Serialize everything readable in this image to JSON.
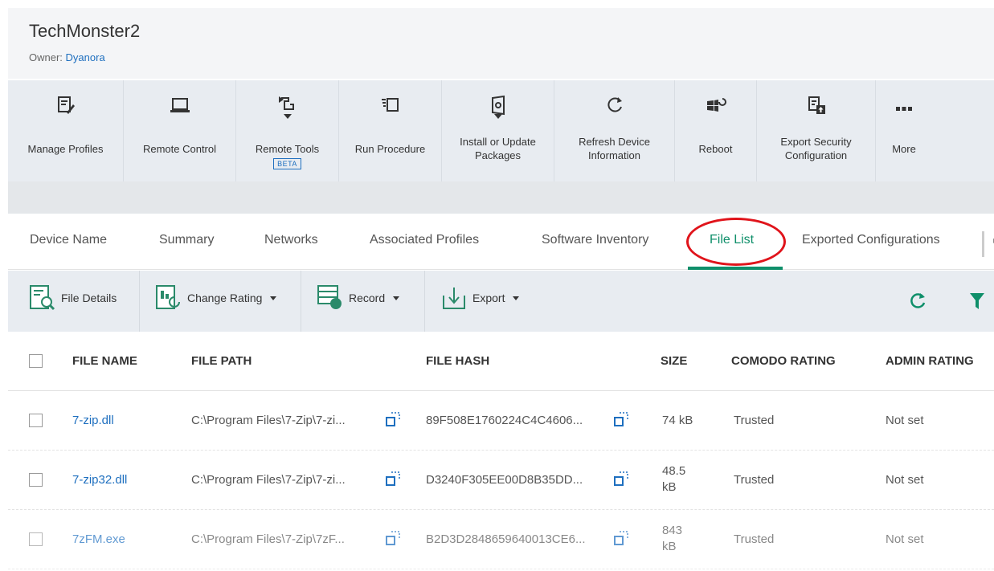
{
  "header": {
    "title": "TechMonster2",
    "owner_label": "Owner:",
    "owner_name": "Dyanora"
  },
  "toolbar": {
    "items": [
      {
        "label": "Manage Profiles",
        "icon": "manage-profiles-icon"
      },
      {
        "label": "Remote Control",
        "icon": "laptop-icon"
      },
      {
        "label": "Remote Tools",
        "icon": "remote-tools-icon",
        "badge": "BETA"
      },
      {
        "label": "Run Procedure",
        "icon": "run-procedure-icon"
      },
      {
        "label": "Install or Update\nPackages",
        "icon": "install-packages-icon"
      },
      {
        "label": "Refresh Device\nInformation",
        "icon": "refresh-icon"
      },
      {
        "label": "Reboot",
        "icon": "reboot-icon"
      },
      {
        "label": "Export Security\nConfiguration",
        "icon": "export-config-icon"
      },
      {
        "label": "More",
        "icon": "more-dots-icon"
      }
    ]
  },
  "tabs": [
    {
      "label": "Device Name"
    },
    {
      "label": "Summary"
    },
    {
      "label": "Networks"
    },
    {
      "label": "Associated Profiles"
    },
    {
      "label": "Software Inventory"
    },
    {
      "label": "File List",
      "active": true
    },
    {
      "label": "Exported Configurations"
    }
  ],
  "actions": {
    "file_details": "File Details",
    "change_rating": "Change Rating",
    "record": "Record",
    "export": "Export"
  },
  "table": {
    "columns": [
      "FILE NAME",
      "FILE PATH",
      "FILE HASH",
      "SIZE",
      "COMODO RATING",
      "ADMIN RATING"
    ],
    "rows": [
      {
        "name": "7-zip.dll",
        "path": "C:\\Program Files\\7-Zip\\7-zi...",
        "hash": "89F508E1760224C4C4606...",
        "size": "74 kB",
        "comodo": "Trusted",
        "admin": "Not set"
      },
      {
        "name": "7-zip32.dll",
        "path": "C:\\Program Files\\7-Zip\\7-zi...",
        "hash": "D3240F305EE00D8B35DD...",
        "size_line1": "48.5",
        "size_line2": "kB",
        "comodo": "Trusted",
        "admin": "Not set"
      },
      {
        "name": "7zFM.exe",
        "path": "C:\\Program Files\\7-Zip\\7zF...",
        "hash": "B2D3D2848659640013CE6...",
        "size_line1": "843",
        "size_line2": "kB",
        "comodo": "Trusted",
        "admin": "Not set"
      }
    ]
  },
  "colors": {
    "accent_green": "#0f8f6a",
    "link_blue": "#1e6fbf",
    "highlight_red": "#e0141b"
  }
}
